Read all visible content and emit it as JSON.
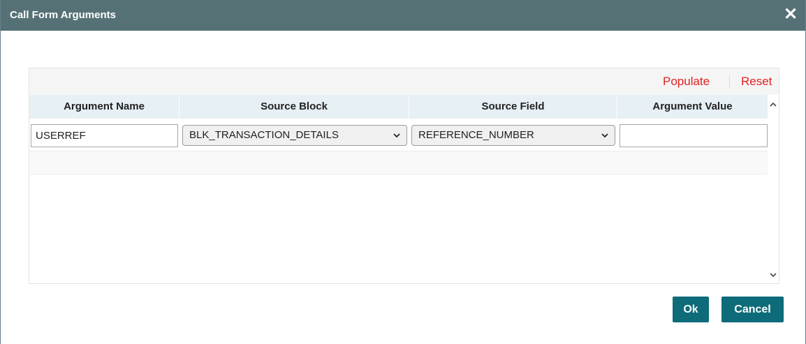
{
  "dialog": {
    "title": "Call Form Arguments",
    "close_label": "✕"
  },
  "toolbar": {
    "populate_label": "Populate",
    "reset_label": "Reset"
  },
  "grid": {
    "columns": [
      "Argument Name",
      "Source Block",
      "Source Field",
      "Argument Value"
    ],
    "rows": [
      {
        "argument_name": "USERREF",
        "source_block": "BLK_TRANSACTION_DETAILS",
        "source_field": "REFERENCE_NUMBER",
        "argument_value": ""
      }
    ]
  },
  "footer": {
    "ok_label": "Ok",
    "cancel_label": "Cancel"
  },
  "colors": {
    "titlebar": "#557176",
    "link": "#e3211f",
    "header_bg": "#e7f0f4",
    "button_bg": "#0e6b79"
  },
  "icons": {
    "close": "close-icon",
    "dropdown": "chevron-down-icon",
    "scroll_up": "chevron-up-icon",
    "scroll_down": "chevron-down-icon"
  }
}
